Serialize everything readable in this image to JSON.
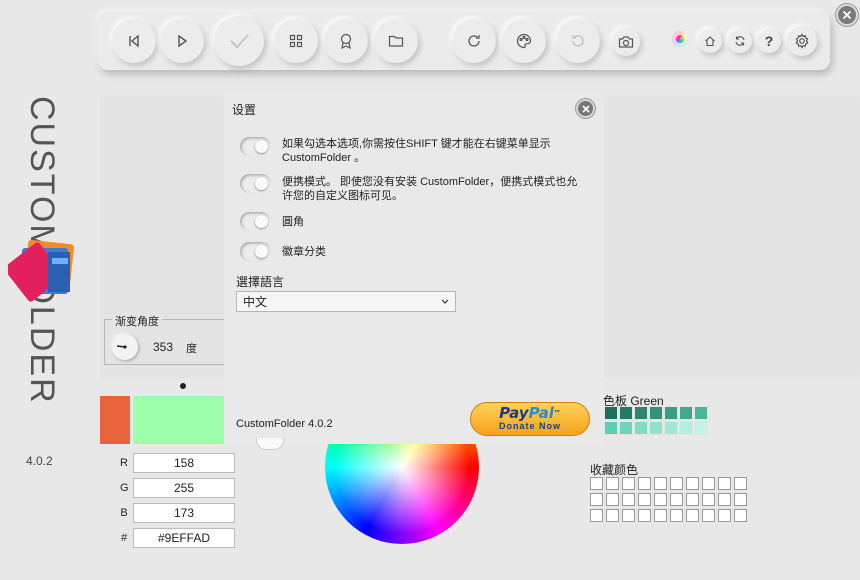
{
  "app": {
    "brand_word": "CUSTOMFOLDER",
    "version": "4.0.2"
  },
  "toolbar": {
    "icons": [
      "previous-icon",
      "play-icon",
      "check-icon",
      "grid-icon",
      "badge-icon",
      "folder-icon",
      "refresh-icon",
      "palette-icon",
      "undo-icon",
      "camera-icon",
      "color-wheel-icon",
      "home-icon",
      "sync-icon",
      "help-icon",
      "gear-icon"
    ],
    "help_glyph": "?"
  },
  "gradient": {
    "legend": "渐变角度",
    "angle": "353",
    "unit": "度"
  },
  "settings": {
    "title": "设置",
    "options": [
      {
        "line1": "如果勾选本选项,你需按住SHIFT 键才能在右键菜单显示",
        "line2": "CustomFolder 。"
      },
      {
        "line1": "便携模式。 即使您没有安装 CustomFolder，便携式模式也允",
        "line2": "许您的自定义图标可见。"
      },
      {
        "line1": "圓角",
        "line2": ""
      },
      {
        "line1": "徽章分类",
        "line2": ""
      }
    ],
    "language_label": "選擇語言",
    "language_value": "中文",
    "about_version": "CustomFolder 4.0.2",
    "paypal_word_1": "Pay",
    "paypal_word_2": "Pal",
    "paypal_tm": "™",
    "paypal_sub": "Donate Now"
  },
  "color": {
    "old_color": "#e8643c",
    "new_color": "#9effad",
    "channels": [
      {
        "label": "R",
        "value": "158"
      },
      {
        "label": "G",
        "value": "255"
      },
      {
        "label": "B",
        "value": "173"
      },
      {
        "label": "#",
        "value": "#9EFFAD"
      }
    ]
  },
  "palette": {
    "label": "色板 Green",
    "row1": [
      "#1e6e5e",
      "#237a68",
      "#2a8672",
      "#31917c",
      "#389d86",
      "#40a990",
      "#49b59a"
    ],
    "row2": [
      "#5ccfb0",
      "#6dd6ba",
      "#7fdcc3",
      "#90e2cc",
      "#a2e8d5",
      "#b3eede",
      "#c4f3e6"
    ]
  },
  "favorites": {
    "label": "收藏颜色",
    "rows": 3,
    "cols": 10
  }
}
